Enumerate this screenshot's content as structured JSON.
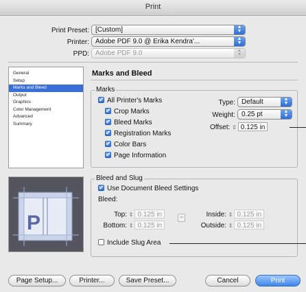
{
  "window": {
    "title": "Print"
  },
  "top": {
    "preset_label": "Print Preset:",
    "preset_value": "[Custom]",
    "printer_label": "Printer:",
    "printer_value": "Adobe PDF 9.0 @ Erika Kendra'...",
    "ppd_label": "PPD:",
    "ppd_value": "Adobe PDF 9.0"
  },
  "sidebar": {
    "items": [
      {
        "label": "General"
      },
      {
        "label": "Setup"
      },
      {
        "label": "Marks and Bleed"
      },
      {
        "label": "Output"
      },
      {
        "label": "Graphics"
      },
      {
        "label": "Color Management"
      },
      {
        "label": "Advanced"
      },
      {
        "label": "Summary"
      }
    ],
    "selected": "Marks and Bleed"
  },
  "pane": {
    "title": "Marks and Bleed"
  },
  "marks": {
    "group_title": "Marks",
    "all": {
      "label": "All Printer's Marks",
      "checked": true
    },
    "items": [
      {
        "label": "Crop Marks",
        "checked": true
      },
      {
        "label": "Bleed Marks",
        "checked": true
      },
      {
        "label": "Registration Marks",
        "checked": true
      },
      {
        "label": "Color Bars",
        "checked": true
      },
      {
        "label": "Page Information",
        "checked": true
      }
    ],
    "type_label": "Type:",
    "type_value": "Default",
    "weight_label": "Weight:",
    "weight_value": "0.25 pt",
    "offset_label": "Offset:",
    "offset_value": "0.125 in"
  },
  "bleed": {
    "group_title": "Bleed and Slug",
    "use_doc": {
      "label": "Use Document Bleed Settings",
      "checked": true
    },
    "bleed_label": "Bleed:",
    "top_label": "Top:",
    "top_value": "0.125 in",
    "bottom_label": "Bottom:",
    "bottom_value": "0.125 in",
    "inside_label": "Inside:",
    "inside_value": "0.125 in",
    "outside_label": "Outside:",
    "outside_value": "0.125 in",
    "slug": {
      "label": "Include Slug Area",
      "checked": false
    }
  },
  "buttons": {
    "page_setup": "Page Setup...",
    "printer": "Printer...",
    "save_preset": "Save Preset...",
    "cancel": "Cancel",
    "print": "Print"
  },
  "colors": {
    "accent": "#3b6fd7",
    "window_bg": "#e9e9e9"
  },
  "preview": {
    "letter": "P"
  }
}
